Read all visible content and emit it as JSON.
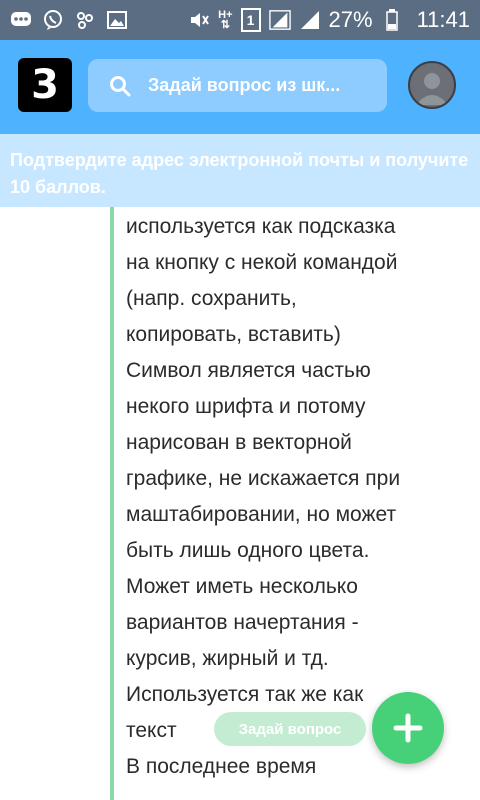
{
  "status_bar": {
    "battery": "27%",
    "time": "11:41",
    "sim_number": "1",
    "network_type": "H+",
    "icons": [
      "chat-icon",
      "viber-icon",
      "people-icon",
      "gallery-icon",
      "mute-icon",
      "data-arrows-icon",
      "signal-icon",
      "battery-icon"
    ]
  },
  "header": {
    "logo_letter": "3",
    "search_placeholder": "Задай вопрос из шк...",
    "avatar": "avatar"
  },
  "banner": {
    "text": "Подтвердите адрес электронной почты и получите 10 баллов."
  },
  "answer": {
    "lines": [
      "используется как подсказка",
      "на кнопку с некой командой",
      "(напр. сохранить,",
      "копировать, вставить)",
      "Символ является частью",
      "некого шрифта и потому",
      "нарисован в векторной",
      "графике, не искажается при",
      "маштабировании, но может",
      "быть лишь одного цвета.",
      "Может иметь несколько",
      "вариантов начертания -",
      "курсив, жирный и тд.",
      "Используется так же как",
      "текст",
      "В последнее время"
    ]
  },
  "actions": {
    "ask_label": "Задай вопрос",
    "fab_icon": "plus-icon"
  },
  "colors": {
    "status_bar": "#5a6d82",
    "header": "#4fb2ff",
    "banner": "#c7e6ff",
    "accent_green": "#46d179"
  }
}
